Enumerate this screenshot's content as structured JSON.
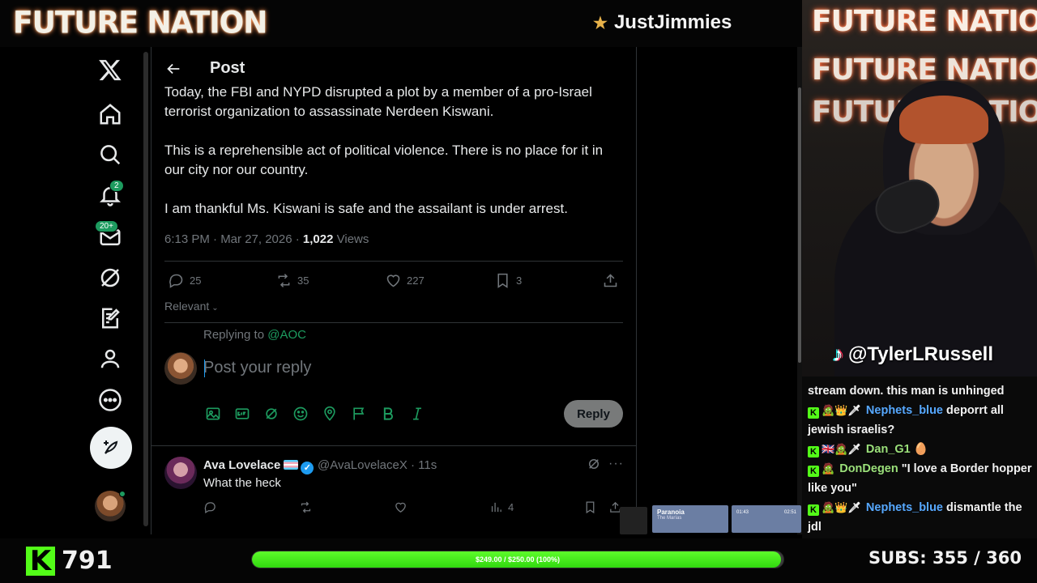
{
  "overlay": {
    "brand": "FUTURE NATION",
    "streamer": "JustJimmies",
    "tiktok_handle": "@TylerLRussell",
    "kick_count": "791",
    "goal_text": "$249.00 / $250.00 (100%)",
    "goal_progress": 0.996,
    "subs_text": "SUBS:  355 / 360",
    "colors": {
      "kick_green": "#53fc18",
      "x_green": "#1d9b5f"
    }
  },
  "nav": {
    "items": [
      "x-logo",
      "home",
      "explore",
      "notifications",
      "messages",
      "grok",
      "articles",
      "profile",
      "more"
    ],
    "notifications_badge": "2",
    "messages_badge": "20+"
  },
  "post": {
    "header_title": "Post",
    "paragraphs": [
      "Today, the FBI and NYPD disrupted a plot by a member of a pro-Israel terrorist organization to assassinate Nerdeen Kiswani.",
      "This is a reprehensible act of political violence. There is no place for it in our city nor our country.",
      "I am thankful Ms. Kiswani is safe and the assailant is under arrest."
    ],
    "time_date": "6:13 PM · Mar 27, 2026 · ",
    "views_count": "1,022",
    "views_label": " Views",
    "replies": "25",
    "reposts": "35",
    "likes": "227",
    "bookmarks": "3",
    "sort_label": "Relevant",
    "replying_to_prefix": "Replying to ",
    "replying_to_handle": "@AOC",
    "reply_placeholder": "Post your reply",
    "reply_button": "Reply"
  },
  "comment": {
    "name": "Ava Lovelace",
    "handle": "@AvaLovelaceX · 11s",
    "text": "What the heck",
    "views": "4"
  },
  "music": {
    "song": "Paranoia",
    "artist": "The Marías",
    "time_current": "01:43",
    "time_total": "02:51"
  },
  "chat": [
    {
      "badges": "",
      "user": "",
      "message": "stream down. this man is unhinged"
    },
    {
      "badges": "K 🧟👑🗡",
      "user": "Nephets_blue",
      "message": "deporrt all jewish israelis?"
    },
    {
      "badges": "K 🇬🇧🧟🗡",
      "user": "Dan_G1",
      "message": "🥚"
    },
    {
      "badges": "K 🧟",
      "user": "DonDegen",
      "message": "\"I love a Border hopper like you\""
    },
    {
      "badges": "K 🧟👑🗡",
      "user": "Nephets_blue",
      "message": "dismantle the jdl"
    }
  ]
}
